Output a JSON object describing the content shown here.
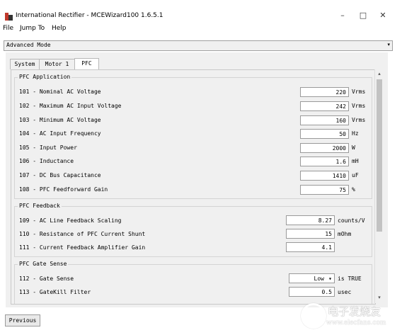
{
  "window": {
    "title": "International Rectifier - MCEWizard100 1.6.5.1",
    "minimize": "–",
    "maximize": "□",
    "close": "✕"
  },
  "menu": [
    "File",
    "Jump To",
    "Help"
  ],
  "mode": {
    "value": "Advanced Mode",
    "arrow": "▾"
  },
  "tabs": [
    "System",
    "Motor 1",
    "PFC"
  ],
  "groups": {
    "application": {
      "title": "PFC Application",
      "rows": [
        {
          "label": "101 - Nominal AC Voltage",
          "value": "220",
          "unit": "Vrms"
        },
        {
          "label": "102 - Maximum AC Input Voltage",
          "value": "242",
          "unit": "Vrms"
        },
        {
          "label": "103 - Minimum AC Voltage",
          "value": "160",
          "unit": "Vrms"
        },
        {
          "label": "104 - AC Input Frequency",
          "value": "50",
          "unit": "Hz"
        },
        {
          "label": "105 - Input Power",
          "value": "2000",
          "unit": "W"
        },
        {
          "label": "106 - Inductance",
          "value": "1.6",
          "unit": "mH"
        },
        {
          "label": "107 - DC Bus Capacitance",
          "value": "1410",
          "unit": "uF"
        },
        {
          "label": "108 - PFC Feedforward Gain",
          "value": "75",
          "unit": "%"
        }
      ]
    },
    "feedback": {
      "title": "PFC Feedback",
      "rows": [
        {
          "label": "109 - AC Line Feedback Scaling",
          "value": "8.27",
          "unit": "counts/V"
        },
        {
          "label": "110 - Resistance of PFC Current Shunt",
          "value": "15",
          "unit": "mOhm"
        },
        {
          "label": "111 - Current Feedback Amplifier Gain",
          "value": "4.1",
          "unit": ""
        }
      ]
    },
    "gate": {
      "title": "PFC Gate Sense",
      "rows": [
        {
          "label": "112 - Gate Sense",
          "value": "Low",
          "unit": "is TRUE"
        },
        {
          "label": "113 - GateKill Filter",
          "value": "0.5",
          "unit": "usec"
        }
      ]
    }
  },
  "scroll": {
    "up": "▴",
    "down": "▾"
  },
  "footer": {
    "previous": "Previous"
  },
  "watermark": {
    "text": "电子发烧友",
    "url": "www.elecfans.com"
  }
}
